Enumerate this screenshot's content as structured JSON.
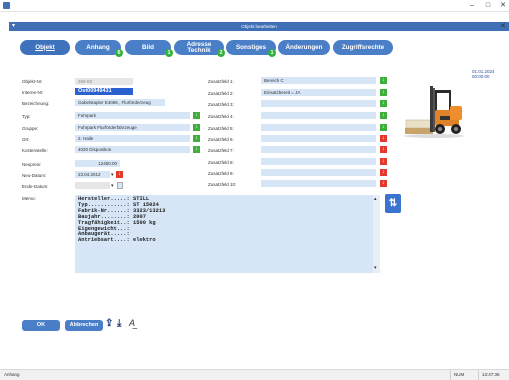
{
  "window": {
    "title": "Objekt bearbeiten",
    "minimize": "–",
    "maximize": "□",
    "close": "✕"
  },
  "header": {
    "title": "Objekt bearbeiten",
    "menu_glyph": "▾",
    "close_glyph": "✕"
  },
  "tabs": [
    {
      "label": "Objekt",
      "badge": ""
    },
    {
      "label": "Anhang",
      "badge": "6"
    },
    {
      "label": "Bild",
      "badge": "1"
    },
    {
      "label": "Adresse\nTechnik",
      "badge": "2"
    },
    {
      "label": "Sonstiges",
      "badge": "1"
    },
    {
      "label": "Änderungen",
      "badge": ""
    },
    {
      "label": "Zugriffsrechte",
      "badge": ""
    }
  ],
  "date_right": "01.01.2024 00:00:00",
  "left_fields": [
    {
      "label": "Objekt-Nr:",
      "value": "269-03"
    },
    {
      "label": "Interne-Nr:",
      "value": "Ost00949431"
    },
    {
      "label": "Bezeichnung:",
      "value": "Gabelstapler E4066 , Flurförderzeug"
    },
    {
      "label": "Typ:",
      "value": "Fuhrpark"
    },
    {
      "label": "Gruppe:",
      "value": "Fuhrpark Flurförderfahrzeuge"
    },
    {
      "label": "Ort:",
      "value": "2. Halle"
    },
    {
      "label": "Kostenstelle:",
      "value": "4020 Disposition"
    },
    {
      "label": "Neupreis:",
      "value": "12450.00"
    },
    {
      "label": "Neu-Datum:",
      "value": "23.04.2012"
    },
    {
      "label": "Ende-Datum:",
      "value": ""
    }
  ],
  "zusatz_fields": [
    {
      "label": "Zusatzfeld 1:",
      "value": "Bereich C"
    },
    {
      "label": "Zusatzfeld 2:",
      "value": "Einsatzbereit = JA"
    },
    {
      "label": "Zusatzfeld 3:",
      "value": ""
    },
    {
      "label": "Zusatzfeld 4:",
      "value": ""
    },
    {
      "label": "Zusatzfeld 5:",
      "value": ""
    },
    {
      "label": "Zusatzfeld 6:",
      "value": ""
    },
    {
      "label": "Zusatzfeld 7:",
      "value": ""
    },
    {
      "label": "Zusatzfeld 8:",
      "value": ""
    },
    {
      "label": "Zusatzfeld 9:",
      "value": ""
    },
    {
      "label": "Zusatzfeld 10:",
      "value": ""
    }
  ],
  "memo": {
    "label": "Memo:",
    "text": "Hersteller.....: STILL\nTyp............: ST 15024\nFabrik-Nr......: 3323/13213\nBaujahr........: 2007\nTragfähigkeit..: 1500 kg\nEigengewicht...:\nAnbaugerät.....:\nAntriebsart....: elektro"
  },
  "buttons": {
    "ok": "OK",
    "cancel": "Abbrechen"
  },
  "statusbar": {
    "left": "Anhang",
    "mid": "NUM",
    "time": "13:47:36"
  },
  "colors": {
    "accent": "#4a7ec6",
    "field": "#d6e6f7",
    "green": "#3fae3a",
    "red": "#e23a2f"
  }
}
